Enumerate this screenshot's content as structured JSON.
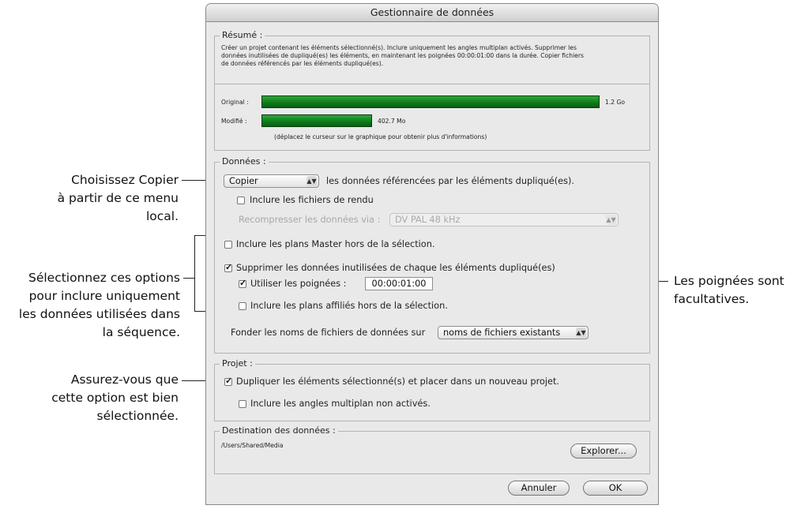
{
  "dialog": {
    "title": "Gestionnaire de données",
    "summary": {
      "legend": "Résumé :",
      "line1": "Créer un projet contenant les éléments sélectionné(s). Inclure uniquement les angles multiplan activés. Supprimer les",
      "line2": "données inutilisées de dupliqué(es) les éléments, en maintenant les poignées 00:00:01:00 dans la durée. Copier fichiers",
      "line3": "de données référencés par les éléments dupliqué(es).",
      "original_label": "Original :",
      "original_value": "1.2 Go",
      "original_fraction": 1.0,
      "modified_label": "Modifié :",
      "modified_value": "402.7 Mo",
      "modified_fraction": 0.328,
      "hint": "(déplacez le curseur sur le graphique pour obtenir plus d'informations)"
    },
    "data": {
      "legend": "Données :",
      "action_value": "Copier",
      "action_suffix": "les données référencées par les éléments dupliqué(es).",
      "include_render": "Inclure les fichiers de rendu",
      "recompress_label": "Recompresser les données via :",
      "recompress_value": "DV PAL 48 kHz",
      "include_master": "Inclure les plans Master hors de la sélection.",
      "delete_unused": "Supprimer les données inutilisées de chaque les éléments dupliqué(es)",
      "use_handles": "Utiliser les poignées :",
      "handles_value": "00:00:01:00",
      "include_affiliated": "Inclure les plans affiliés hors de la sélection.",
      "base_names_label": "Fonder les noms de fichiers de données sur",
      "base_names_value": "noms de fichiers existants"
    },
    "project": {
      "legend": "Projet :",
      "duplicate": "Dupliquer les éléments sélectionné(s) et placer dans un nouveau projet.",
      "include_angles": "Inclure les angles multiplan non activés."
    },
    "destination": {
      "legend": "Destination des données :",
      "path": "/Users/Shared/Media",
      "browse": "Explorer..."
    },
    "cancel": "Annuler",
    "ok": "OK"
  },
  "annotations": {
    "copy_1": "Choisissez Copier",
    "copy_2": "à partir de ce menu local.",
    "select_1": "Sélectionnez ces options",
    "select_2": "pour inclure uniquement",
    "select_3": "les données utilisées dans",
    "select_4": "la séquence.",
    "ensure_1": "Assurez-vous que",
    "ensure_2": "cette option est bien",
    "ensure_3": "sélectionnée.",
    "handles_1": "Les poignées sont",
    "handles_2": "facultatives."
  }
}
